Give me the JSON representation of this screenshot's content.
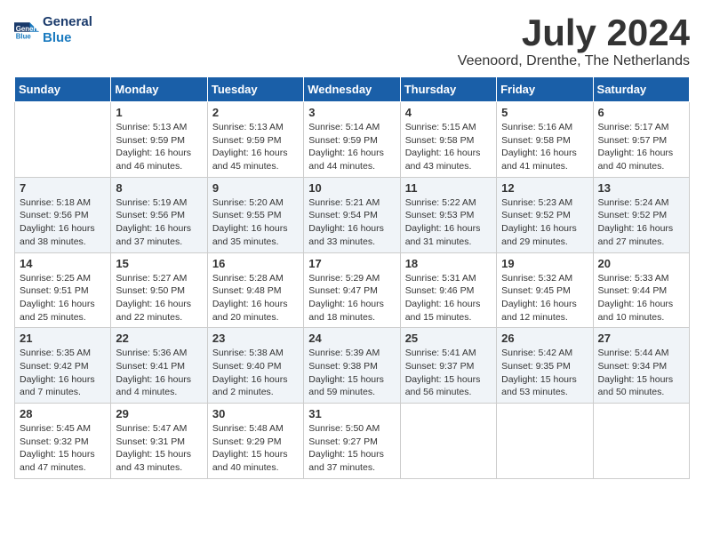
{
  "header": {
    "logo_line1": "General",
    "logo_line2": "Blue",
    "month": "July 2024",
    "location": "Veenoord, Drenthe, The Netherlands"
  },
  "weekdays": [
    "Sunday",
    "Monday",
    "Tuesday",
    "Wednesday",
    "Thursday",
    "Friday",
    "Saturday"
  ],
  "weeks": [
    [
      {
        "day": "",
        "info": ""
      },
      {
        "day": "1",
        "info": "Sunrise: 5:13 AM\nSunset: 9:59 PM\nDaylight: 16 hours\nand 46 minutes."
      },
      {
        "day": "2",
        "info": "Sunrise: 5:13 AM\nSunset: 9:59 PM\nDaylight: 16 hours\nand 45 minutes."
      },
      {
        "day": "3",
        "info": "Sunrise: 5:14 AM\nSunset: 9:59 PM\nDaylight: 16 hours\nand 44 minutes."
      },
      {
        "day": "4",
        "info": "Sunrise: 5:15 AM\nSunset: 9:58 PM\nDaylight: 16 hours\nand 43 minutes."
      },
      {
        "day": "5",
        "info": "Sunrise: 5:16 AM\nSunset: 9:58 PM\nDaylight: 16 hours\nand 41 minutes."
      },
      {
        "day": "6",
        "info": "Sunrise: 5:17 AM\nSunset: 9:57 PM\nDaylight: 16 hours\nand 40 minutes."
      }
    ],
    [
      {
        "day": "7",
        "info": "Sunrise: 5:18 AM\nSunset: 9:56 PM\nDaylight: 16 hours\nand 38 minutes."
      },
      {
        "day": "8",
        "info": "Sunrise: 5:19 AM\nSunset: 9:56 PM\nDaylight: 16 hours\nand 37 minutes."
      },
      {
        "day": "9",
        "info": "Sunrise: 5:20 AM\nSunset: 9:55 PM\nDaylight: 16 hours\nand 35 minutes."
      },
      {
        "day": "10",
        "info": "Sunrise: 5:21 AM\nSunset: 9:54 PM\nDaylight: 16 hours\nand 33 minutes."
      },
      {
        "day": "11",
        "info": "Sunrise: 5:22 AM\nSunset: 9:53 PM\nDaylight: 16 hours\nand 31 minutes."
      },
      {
        "day": "12",
        "info": "Sunrise: 5:23 AM\nSunset: 9:52 PM\nDaylight: 16 hours\nand 29 minutes."
      },
      {
        "day": "13",
        "info": "Sunrise: 5:24 AM\nSunset: 9:52 PM\nDaylight: 16 hours\nand 27 minutes."
      }
    ],
    [
      {
        "day": "14",
        "info": "Sunrise: 5:25 AM\nSunset: 9:51 PM\nDaylight: 16 hours\nand 25 minutes."
      },
      {
        "day": "15",
        "info": "Sunrise: 5:27 AM\nSunset: 9:50 PM\nDaylight: 16 hours\nand 22 minutes."
      },
      {
        "day": "16",
        "info": "Sunrise: 5:28 AM\nSunset: 9:48 PM\nDaylight: 16 hours\nand 20 minutes."
      },
      {
        "day": "17",
        "info": "Sunrise: 5:29 AM\nSunset: 9:47 PM\nDaylight: 16 hours\nand 18 minutes."
      },
      {
        "day": "18",
        "info": "Sunrise: 5:31 AM\nSunset: 9:46 PM\nDaylight: 16 hours\nand 15 minutes."
      },
      {
        "day": "19",
        "info": "Sunrise: 5:32 AM\nSunset: 9:45 PM\nDaylight: 16 hours\nand 12 minutes."
      },
      {
        "day": "20",
        "info": "Sunrise: 5:33 AM\nSunset: 9:44 PM\nDaylight: 16 hours\nand 10 minutes."
      }
    ],
    [
      {
        "day": "21",
        "info": "Sunrise: 5:35 AM\nSunset: 9:42 PM\nDaylight: 16 hours\nand 7 minutes."
      },
      {
        "day": "22",
        "info": "Sunrise: 5:36 AM\nSunset: 9:41 PM\nDaylight: 16 hours\nand 4 minutes."
      },
      {
        "day": "23",
        "info": "Sunrise: 5:38 AM\nSunset: 9:40 PM\nDaylight: 16 hours\nand 2 minutes."
      },
      {
        "day": "24",
        "info": "Sunrise: 5:39 AM\nSunset: 9:38 PM\nDaylight: 15 hours\nand 59 minutes."
      },
      {
        "day": "25",
        "info": "Sunrise: 5:41 AM\nSunset: 9:37 PM\nDaylight: 15 hours\nand 56 minutes."
      },
      {
        "day": "26",
        "info": "Sunrise: 5:42 AM\nSunset: 9:35 PM\nDaylight: 15 hours\nand 53 minutes."
      },
      {
        "day": "27",
        "info": "Sunrise: 5:44 AM\nSunset: 9:34 PM\nDaylight: 15 hours\nand 50 minutes."
      }
    ],
    [
      {
        "day": "28",
        "info": "Sunrise: 5:45 AM\nSunset: 9:32 PM\nDaylight: 15 hours\nand 47 minutes."
      },
      {
        "day": "29",
        "info": "Sunrise: 5:47 AM\nSunset: 9:31 PM\nDaylight: 15 hours\nand 43 minutes."
      },
      {
        "day": "30",
        "info": "Sunrise: 5:48 AM\nSunset: 9:29 PM\nDaylight: 15 hours\nand 40 minutes."
      },
      {
        "day": "31",
        "info": "Sunrise: 5:50 AM\nSunset: 9:27 PM\nDaylight: 15 hours\nand 37 minutes."
      },
      {
        "day": "",
        "info": ""
      },
      {
        "day": "",
        "info": ""
      },
      {
        "day": "",
        "info": ""
      }
    ]
  ]
}
